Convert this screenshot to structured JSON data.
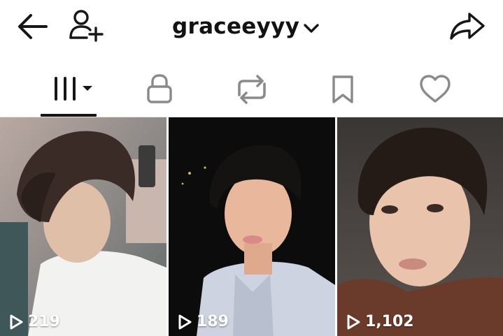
{
  "header": {
    "username": "graceeyyy",
    "icons": {
      "back": "back-arrow-icon",
      "add_user": "add-user-icon",
      "switch_account": "chevron-down-icon",
      "share": "share-icon"
    }
  },
  "tabs": [
    {
      "name": "videos",
      "icon": "video-grid-icon",
      "active": true
    },
    {
      "name": "private",
      "icon": "lock-icon",
      "active": false
    },
    {
      "name": "reposts",
      "icon": "repost-icon",
      "active": false
    },
    {
      "name": "saved",
      "icon": "bookmark-icon",
      "active": false
    },
    {
      "name": "liked",
      "icon": "heart-icon",
      "active": false
    }
  ],
  "videos": [
    {
      "views": "219"
    },
    {
      "views": "189"
    },
    {
      "views": "1,102"
    }
  ],
  "colors": {
    "text": "#121212",
    "icon_inactive": "#8a8a8a",
    "active_underline": "#161616",
    "view_count": "#ffffff"
  }
}
